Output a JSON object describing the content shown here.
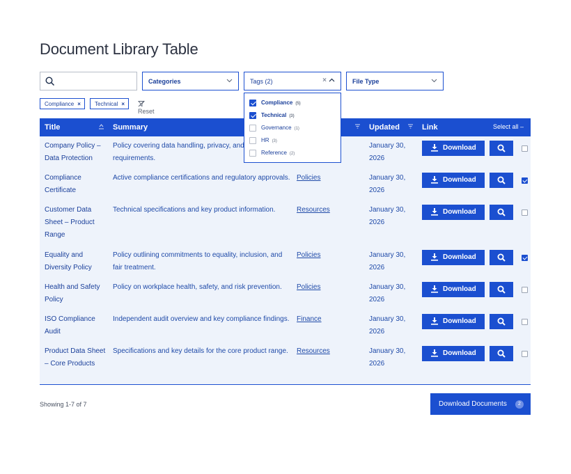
{
  "page": {
    "title": "Document Library Table"
  },
  "filters": {
    "search_placeholder": "",
    "categories_label": "Categories",
    "tags_label": "Tags (2)",
    "tags_clear": "×",
    "filetype_label": "File Type"
  },
  "active_chips": [
    {
      "label": "Compliance",
      "remove": "×"
    },
    {
      "label": "Technical",
      "remove": "×"
    }
  ],
  "reset_label": "Reset",
  "tags_dropdown": [
    {
      "label": "Compliance",
      "count": "(5)",
      "checked": true
    },
    {
      "label": "Technical",
      "count": "(3)",
      "checked": true
    },
    {
      "label": "Governance",
      "count": "(1)",
      "checked": false
    },
    {
      "label": "HR",
      "count": "(3)",
      "checked": false
    },
    {
      "label": "Reference",
      "count": "(2)",
      "checked": false
    }
  ],
  "table": {
    "headers": {
      "title": "Title",
      "summary": "Summary",
      "updated": "Updated",
      "link": "Link",
      "select_all": "Select all –"
    },
    "download_label": "Download",
    "rows": [
      {
        "title": "Company Policy – Data Protection",
        "summary": "Policy covering data handling, privacy, and compliance requirements.",
        "category": "",
        "date": "January 30, 2026",
        "checked": false
      },
      {
        "title": "Compliance Certificate",
        "summary": "Active compliance certifications and regulatory approvals.",
        "category": "Policies",
        "date": "January 30, 2026",
        "checked": true
      },
      {
        "title": "Customer Data Sheet – Product Range",
        "summary": "Technical specifications and key product information.",
        "category": "Resources",
        "date": "January 30, 2026",
        "checked": false
      },
      {
        "title": "Equality and Diversity Policy",
        "summary": "Policy outlining commitments to equality, inclusion, and fair treatment.",
        "category": "Policies",
        "date": "January 30, 2026",
        "checked": true
      },
      {
        "title": "Health and Safety Policy",
        "summary": "Policy on workplace health, safety, and risk prevention.",
        "category": "Policies",
        "date": "January 30, 2026",
        "checked": false
      },
      {
        "title": "ISO Compliance Audit",
        "summary": "Independent audit overview and key compliance findings.",
        "category": "Finance",
        "date": "January 30, 2026",
        "checked": false
      },
      {
        "title": "Product Data Sheet – Core Products",
        "summary": "Specifications and key details for the core product range.",
        "category": "Resources",
        "date": "January 30, 2026",
        "checked": false
      }
    ]
  },
  "footer": {
    "showing": "Showing 1-7 of 7",
    "download_docs_label": "Download Documents",
    "download_docs_count": "2"
  },
  "colors": {
    "primary": "#1b4fd0",
    "row_bg": "#eef3fb",
    "text_link": "#1a3f9a"
  }
}
